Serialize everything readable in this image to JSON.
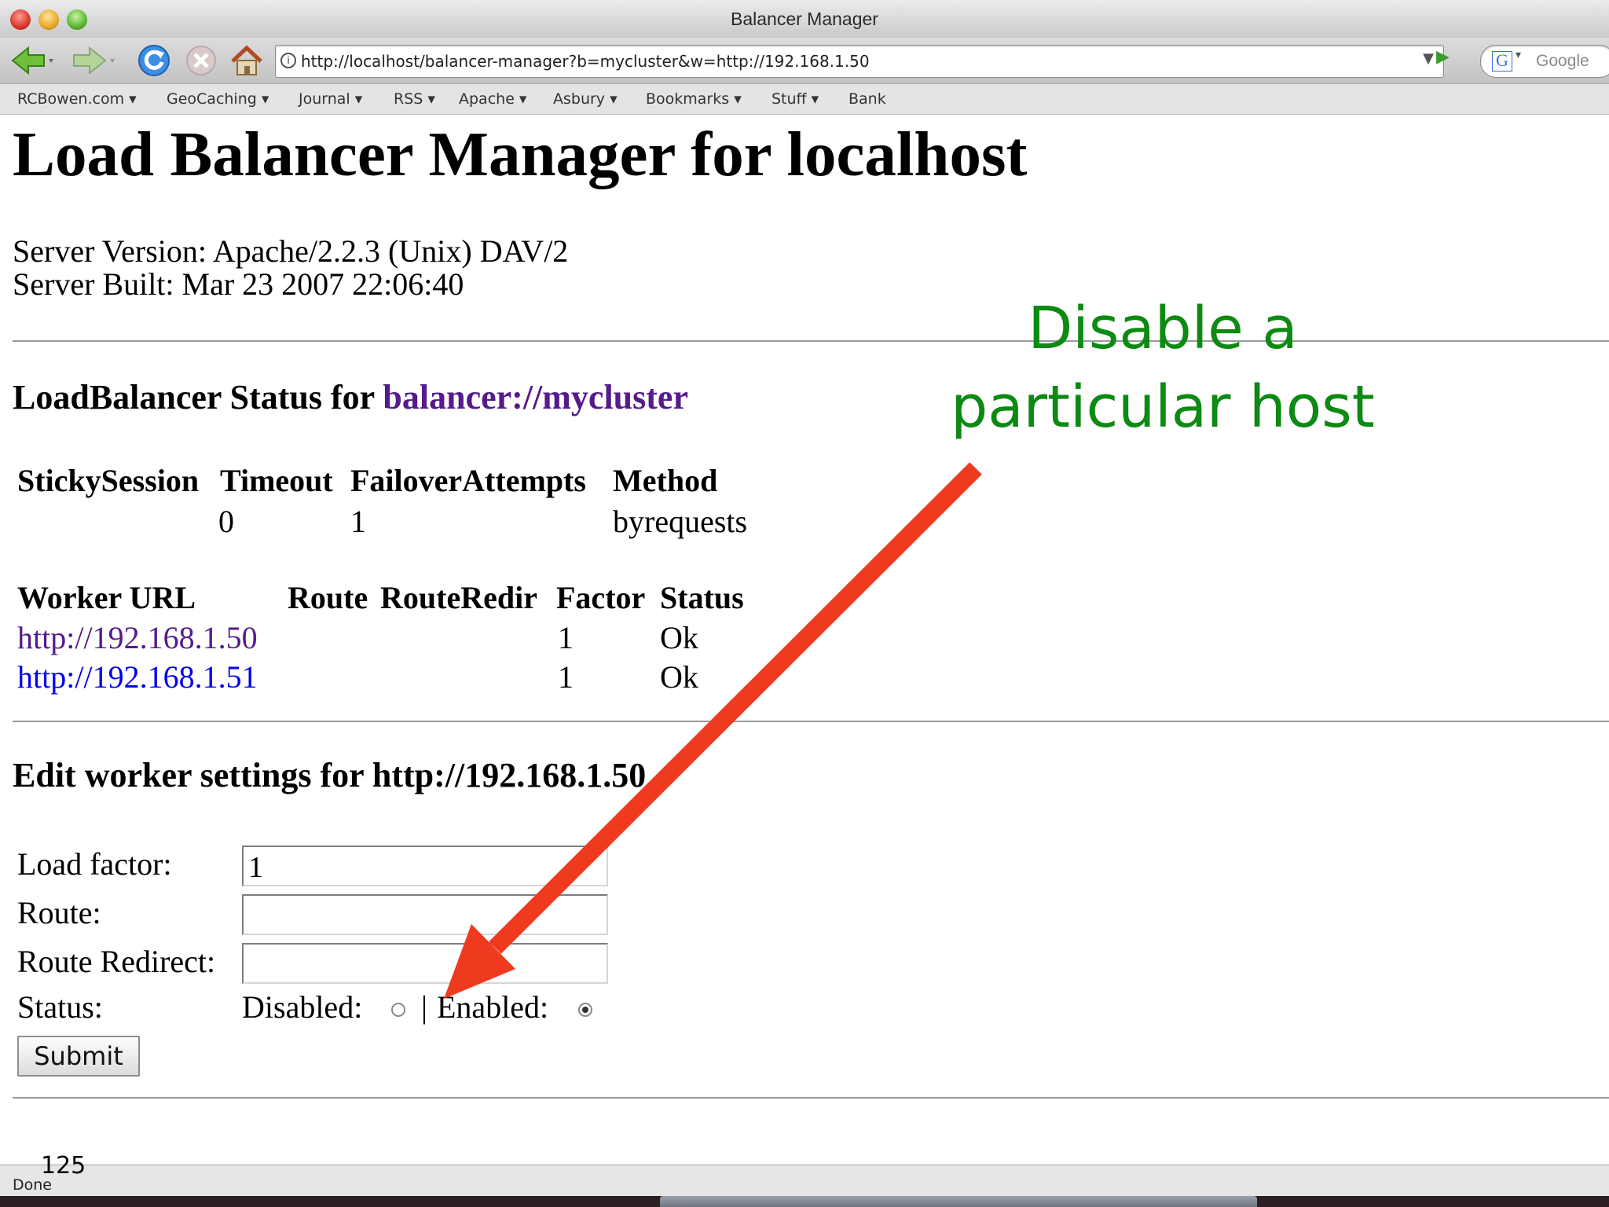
{
  "window": {
    "title": "Balancer Manager"
  },
  "toolbar": {
    "url": "http://localhost/balancer-manager?b=mycluster&w=http://192.168.1.50",
    "search_placeholder": "Google",
    "icons": [
      "back-icon",
      "forward-icon",
      "reload-icon",
      "stop-icon",
      "home-icon",
      "go-icon"
    ]
  },
  "bookmarks": [
    {
      "label": "RCBowen.com ▾"
    },
    {
      "label": "GeoCaching ▾"
    },
    {
      "label": "Journal ▾"
    },
    {
      "label": "RSS ▾"
    },
    {
      "label": "Apache ▾"
    },
    {
      "label": "Asbury ▾"
    },
    {
      "label": "Bookmarks ▾"
    },
    {
      "label": "Stuff ▾"
    },
    {
      "label": "Bank"
    }
  ],
  "page": {
    "title": "Load Balancer Manager for localhost",
    "server_version": "Server Version: Apache/2.2.3 (Unix) DAV/2",
    "server_built": "Server Built: Mar 23 2007 22:06:40",
    "lb_heading_prefix": "LoadBalancer Status for ",
    "lb_link": "balancer://mycluster",
    "lb_table": {
      "headers": [
        "StickySession",
        "Timeout",
        "FailoverAttempts",
        "Method"
      ],
      "row": [
        "",
        "0",
        "1",
        "byrequests"
      ]
    },
    "workers_table": {
      "headers": [
        "Worker URL",
        "Route",
        "RouteRedir",
        "Factor",
        "Status"
      ],
      "rows": [
        {
          "url": "http://192.168.1.50",
          "route": "",
          "routeredir": "",
          "factor": "1",
          "status": "Ok"
        },
        {
          "url": "http://192.168.1.51",
          "route": "",
          "routeredir": "",
          "factor": "1",
          "status": "Ok"
        }
      ]
    },
    "edit_heading": "Edit worker settings for http://192.168.1.50",
    "form": {
      "load_factor_label": "Load factor:",
      "load_factor_value": "1",
      "route_label": "Route:",
      "route_value": "",
      "route_redirect_label": "Route Redirect:",
      "route_redirect_value": "",
      "status_label": "Status:",
      "disabled_label": "Disabled:",
      "separator": "|",
      "enabled_label": "Enabled:",
      "status_selected": "Enabled",
      "submit_label": "Submit"
    }
  },
  "annotation": {
    "line1": "Disable a",
    "line2": "particular host",
    "text_color": "#0c8a12",
    "arrow_color": "#f03a20"
  },
  "statusbar": {
    "text": "Done"
  },
  "slide_number": "125"
}
